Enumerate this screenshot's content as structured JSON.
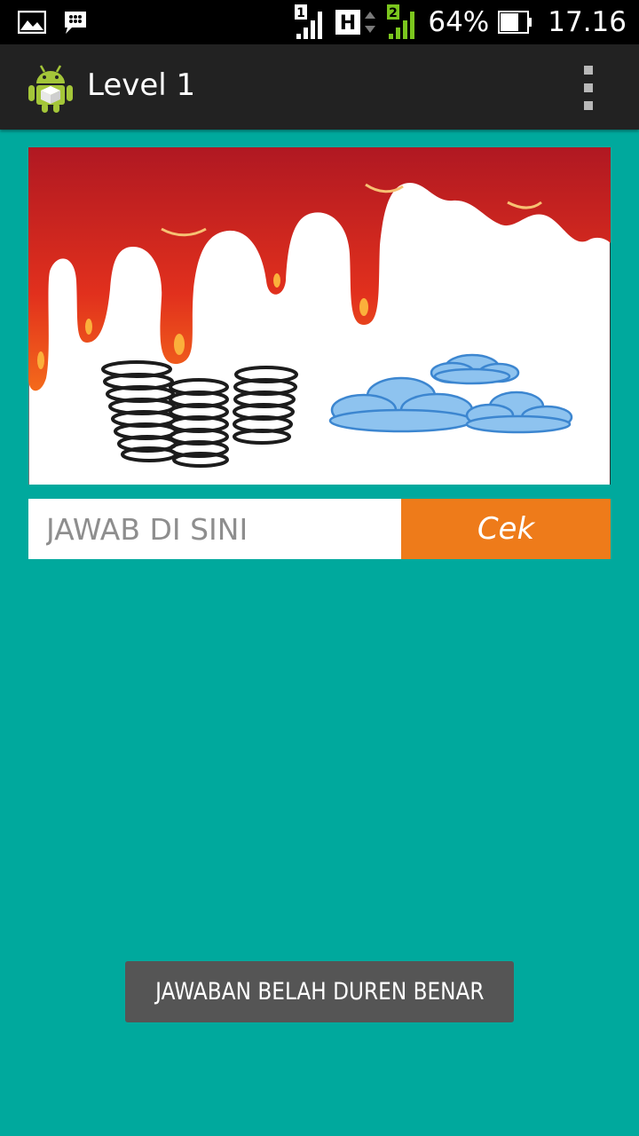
{
  "status_bar": {
    "left_icons": [
      "image-icon",
      "bbm-chat-icon"
    ],
    "sim1_label": "1",
    "network_type": "H",
    "sim2_label": "2",
    "battery_percent": "64%",
    "time": "17.16",
    "sim2_color": "#7bc61e"
  },
  "action_bar": {
    "title": "Level 1",
    "app_icon": "android-icon",
    "menu_icon": "overflow-menu-icon"
  },
  "puzzle": {
    "image_icon": "puzzle-picture",
    "depicts": [
      "paint-drip-icon",
      "spring-icon",
      "cloud-icon"
    ]
  },
  "answer": {
    "placeholder": "JAWAB DI SINI",
    "value": "",
    "check_label": "Cek"
  },
  "toast": {
    "message": "JAWABAN BELAH DUREN BENAR"
  },
  "colors": {
    "background": "#00a99d",
    "action_bar": "#222222",
    "check_button": "#ee7b1a",
    "toast": "#555555"
  }
}
